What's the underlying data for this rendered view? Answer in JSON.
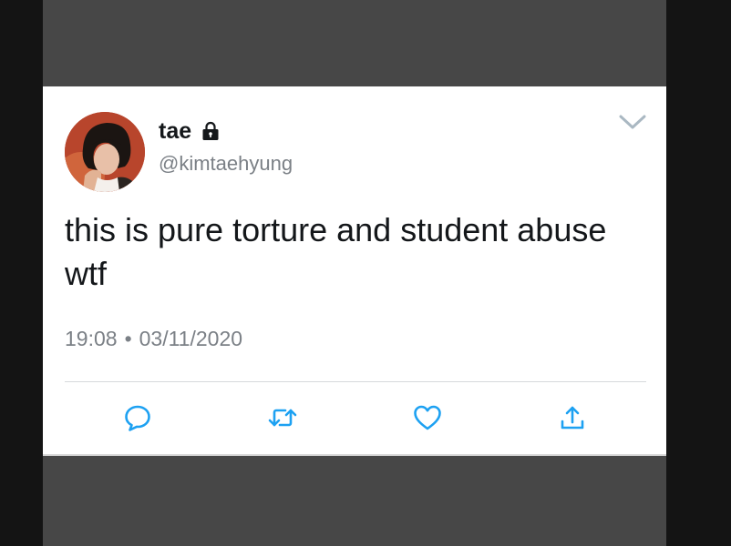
{
  "tweet": {
    "display_name": "tae",
    "handle": "@kimtaehyung",
    "text": "this is pure torture and student abuse wtf",
    "time": "19:08",
    "separator": "•",
    "date": "03/11/2020",
    "protected": true
  },
  "icons": {
    "lock": "lock-icon",
    "menu": "chevron-down-icon",
    "reply": "reply-icon",
    "retweet": "retweet-icon",
    "like": "heart-icon",
    "share": "share-icon"
  },
  "colors": {
    "accent": "#1da1f2",
    "text": "#14171a",
    "muted": "#7b8086",
    "backdrop": "#474747",
    "outer": "#141414"
  }
}
